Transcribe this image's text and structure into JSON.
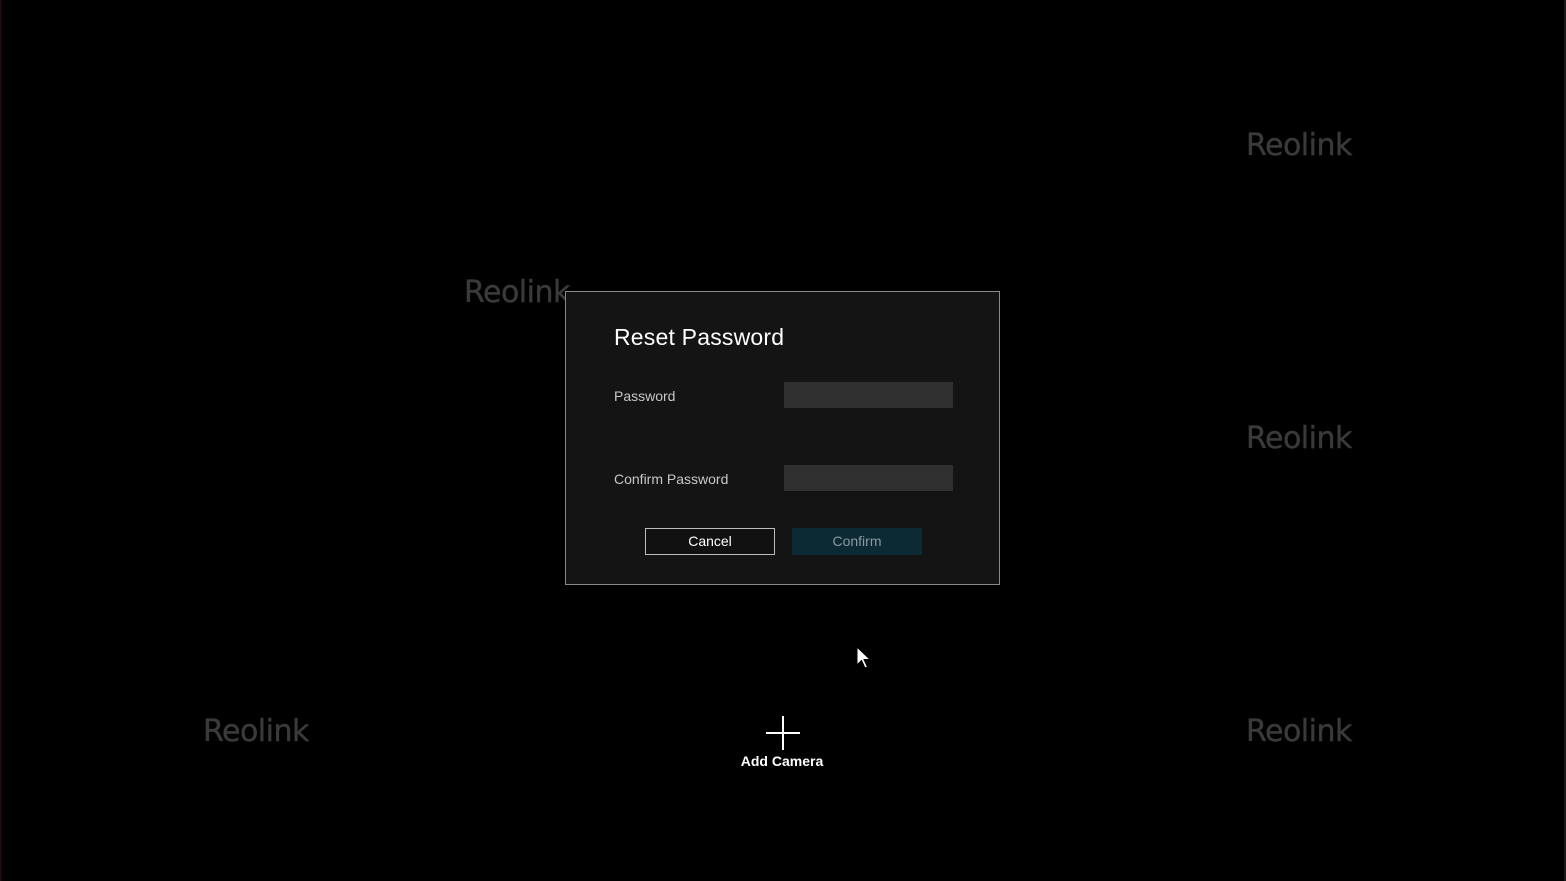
{
  "watermark": {
    "brand": "Reolink"
  },
  "dialog": {
    "title": "Reset Password",
    "password_label": "Password",
    "password_value": "",
    "confirm_label": "Confirm Password",
    "confirm_value": "",
    "cancel_label": "Cancel",
    "confirm_button_label": "Confirm"
  },
  "add_camera": {
    "label": "Add Camera",
    "icon": "plus-icon"
  },
  "colors": {
    "background": "#000000",
    "dialog_bg": "#141414",
    "input_bg": "#303030",
    "confirm_button_bg": "#0c2a34",
    "watermark": "#3a3a3a"
  }
}
